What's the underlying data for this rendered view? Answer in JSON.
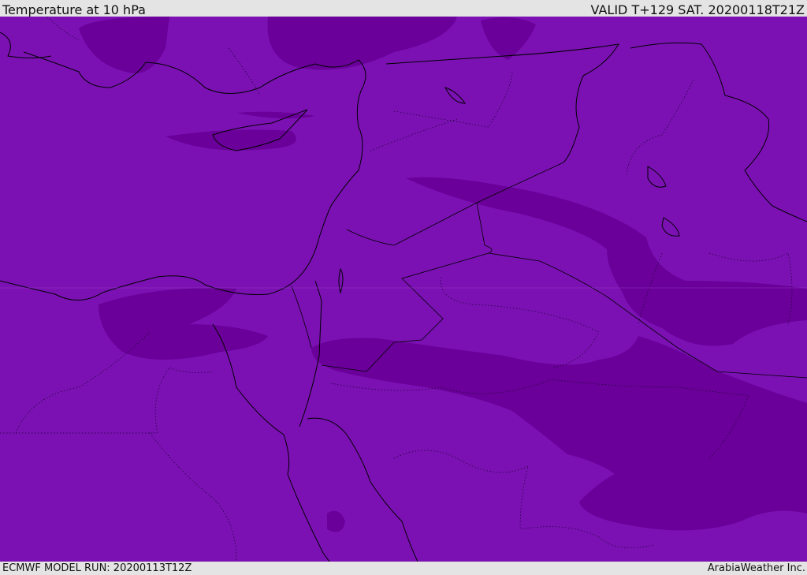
{
  "header": {
    "title": "Temperature at 10 hPa",
    "valid": "VALID T+129 SAT. 20200118T21Z"
  },
  "footer": {
    "model_run": "ECMWF MODEL RUN: 20200113T12Z",
    "credit": "ArabiaWeather Inc."
  },
  "map": {
    "region": "Eastern Mediterranean / Middle East",
    "field": "temperature",
    "level": "10 hPa",
    "colors": {
      "base": "#7b11b3",
      "colder": "#6a0099",
      "coastline": "#000000",
      "borders": "#1a0030"
    }
  }
}
